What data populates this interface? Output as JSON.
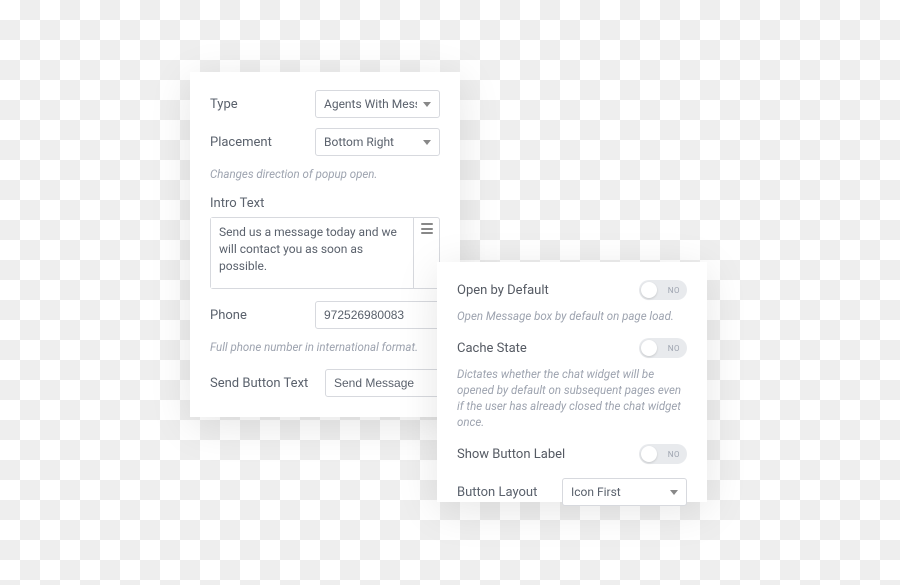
{
  "left": {
    "type": {
      "label": "Type",
      "value": "Agents With Messa"
    },
    "placement": {
      "label": "Placement",
      "value": "Bottom Right",
      "helper": "Changes direction of popup open."
    },
    "intro": {
      "label": "Intro Text",
      "value": "Send us a message today and we will contact you as soon as possible."
    },
    "phone": {
      "label": "Phone",
      "value": "972526980083",
      "helper": "Full phone number in international format."
    },
    "sendButton": {
      "label": "Send Button Text",
      "value": "Send Message"
    }
  },
  "right": {
    "openDefault": {
      "label": "Open by Default",
      "state": "NO",
      "helper": "Open Message box by default on page load."
    },
    "cacheState": {
      "label": "Cache State",
      "state": "NO",
      "helper": "Dictates whether the chat widget will be opened by default on subsequent pages even if the user has already closed the chat widget once."
    },
    "showButtonLabel": {
      "label": "Show Button Label",
      "state": "NO"
    },
    "buttonLayout": {
      "label": "Button Layout",
      "value": "Icon First"
    }
  }
}
